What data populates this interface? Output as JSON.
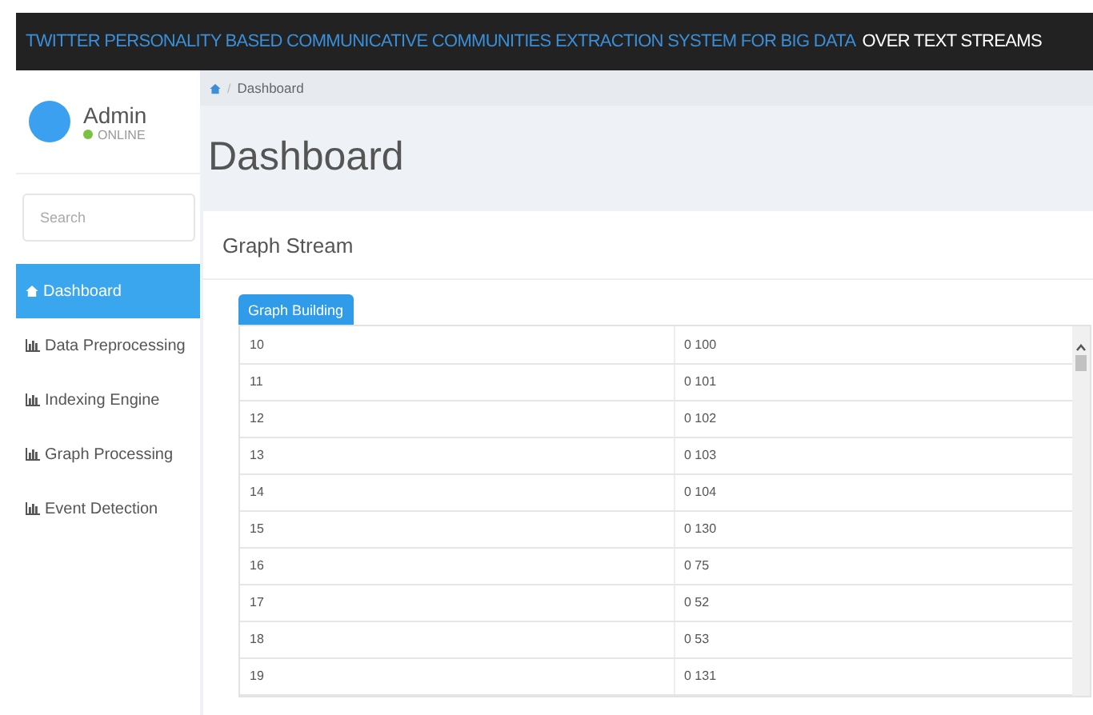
{
  "header": {
    "title_accent": "TWITTER PERSONALITY BASED COMMUNICATIVE COMMUNITIES EXTRACTION SYSTEM FOR BIG DATA",
    "title_rest": "OVER TEXT STREAMS"
  },
  "user": {
    "name": "Admin",
    "status": "ONLINE",
    "online": true
  },
  "search": {
    "placeholder": "Search"
  },
  "sidebar": {
    "items": [
      {
        "label": "Dashboard",
        "kind": "home",
        "selected": true
      },
      {
        "label": "Data Preprocessing",
        "kind": "chart",
        "selected": false
      },
      {
        "label": "Indexing Engine",
        "kind": "chart",
        "selected": false
      },
      {
        "label": "Graph Processing",
        "kind": "chart",
        "selected": false
      },
      {
        "label": "Event Detection",
        "kind": "chart",
        "selected": false
      }
    ]
  },
  "breadcrumb_separator": "/",
  "breadcrumb": "Dashboard",
  "page_title": "Dashboard",
  "panel": {
    "title": "Graph Stream",
    "button": "Graph Building"
  },
  "table": {
    "rows": [
      [
        "10",
        "0 100"
      ],
      [
        "11",
        "0 101"
      ],
      [
        "12",
        "0 102"
      ],
      [
        "13",
        "0 103"
      ],
      [
        "14",
        "0 104"
      ],
      [
        "15",
        "0 130"
      ],
      [
        "16",
        "0 75"
      ],
      [
        "17",
        "0 52"
      ],
      [
        "18",
        "0 53"
      ],
      [
        "19",
        "0 131"
      ]
    ]
  }
}
